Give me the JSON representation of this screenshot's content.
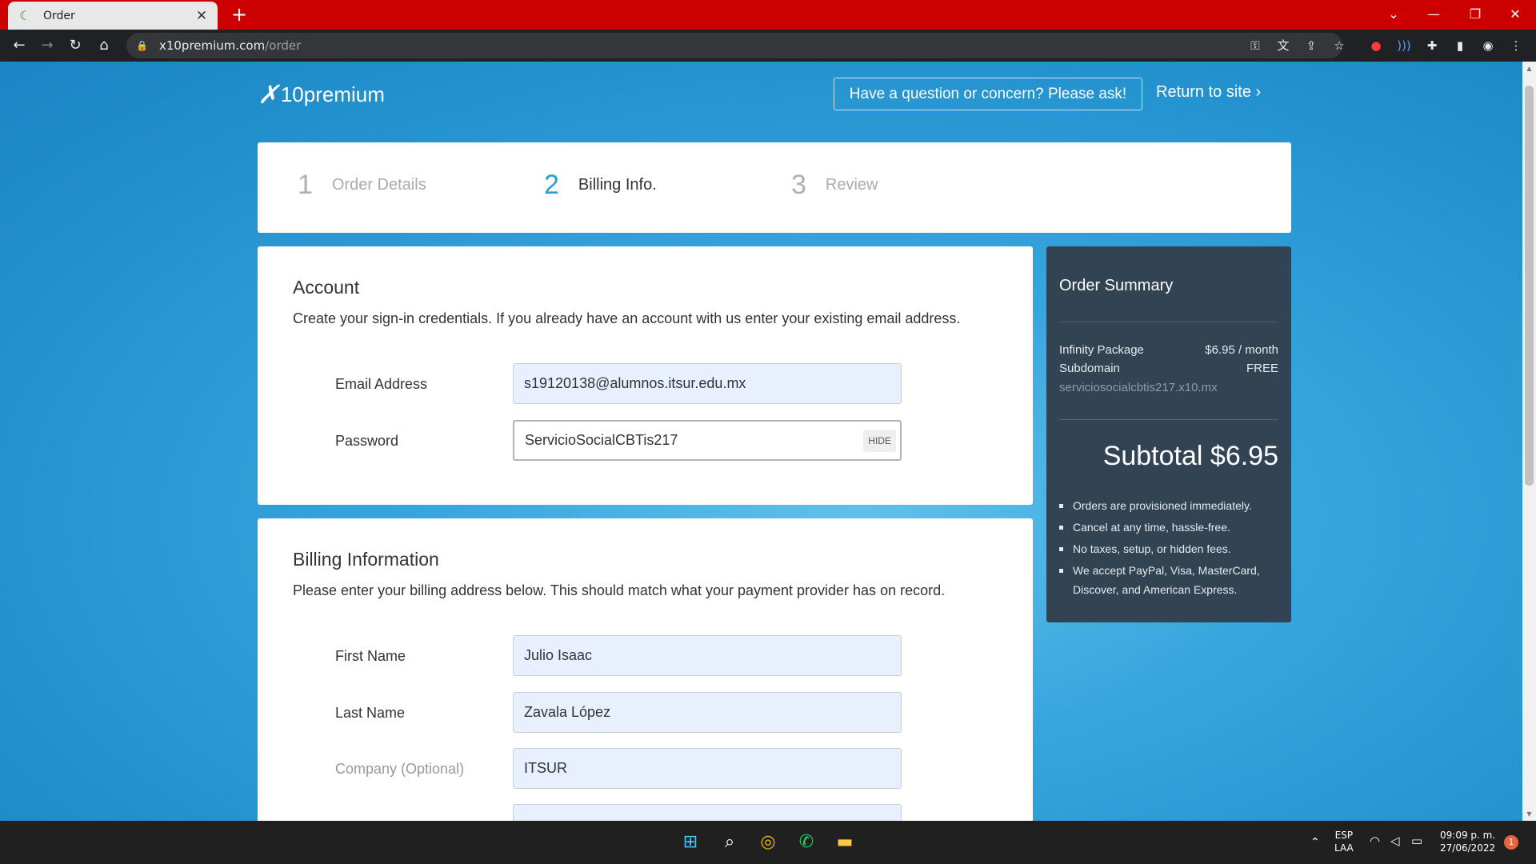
{
  "browser": {
    "tab_title": "Order",
    "url_host": "x10premium.com",
    "url_path": "/order"
  },
  "header": {
    "logo_text": "10premium",
    "ask_button": "Have a question or concern? Please ask!",
    "return_link": "Return to site ›"
  },
  "steps": [
    {
      "num": "1",
      "label": "Order Details",
      "active": false
    },
    {
      "num": "2",
      "label": "Billing Info.",
      "active": true
    },
    {
      "num": "3",
      "label": "Review",
      "active": false
    }
  ],
  "account": {
    "title": "Account",
    "description": "Create your sign-in credentials. If you already have an account with us enter your existing email address.",
    "email_label": "Email Address",
    "email_value": "s19120138@alumnos.itsur.edu.mx",
    "password_label": "Password",
    "password_value": "ServicioSocialCBTis217",
    "hide_label": "HIDE"
  },
  "billing": {
    "title": "Billing Information",
    "description": "Please enter your billing address below. This should match what your payment provider has on record.",
    "first_name_label": "First Name",
    "first_name_value": "Julio Isaac",
    "last_name_label": "Last Name",
    "last_name_value": "Zavala López",
    "company_label": "Company (Optional)",
    "company_value": "ITSUR"
  },
  "summary": {
    "title": "Order Summary",
    "package_label": "Infinity Package",
    "package_price": "$6.95 / month",
    "subdomain_label": "Subdomain",
    "subdomain_price": "FREE",
    "subdomain_value": "serviciosocialcbtis217.x10.mx",
    "subtotal_label": "Subtotal",
    "subtotal_value": "$6.95",
    "bullets": [
      "Orders are provisioned immediately.",
      "Cancel at any time, hassle-free.",
      "No taxes, setup, or hidden fees.",
      "We accept PayPal, Visa, MasterCard, Discover, and American Express."
    ]
  },
  "taskbar": {
    "lang_top": "ESP",
    "lang_bottom": "LAA",
    "time": "09:09 p. m.",
    "date": "27/06/2022",
    "notification_count": "1"
  },
  "colors": {
    "tab_strip": "#cc0000",
    "accent": "#2a9fd6",
    "summary_bg": "#324454"
  }
}
